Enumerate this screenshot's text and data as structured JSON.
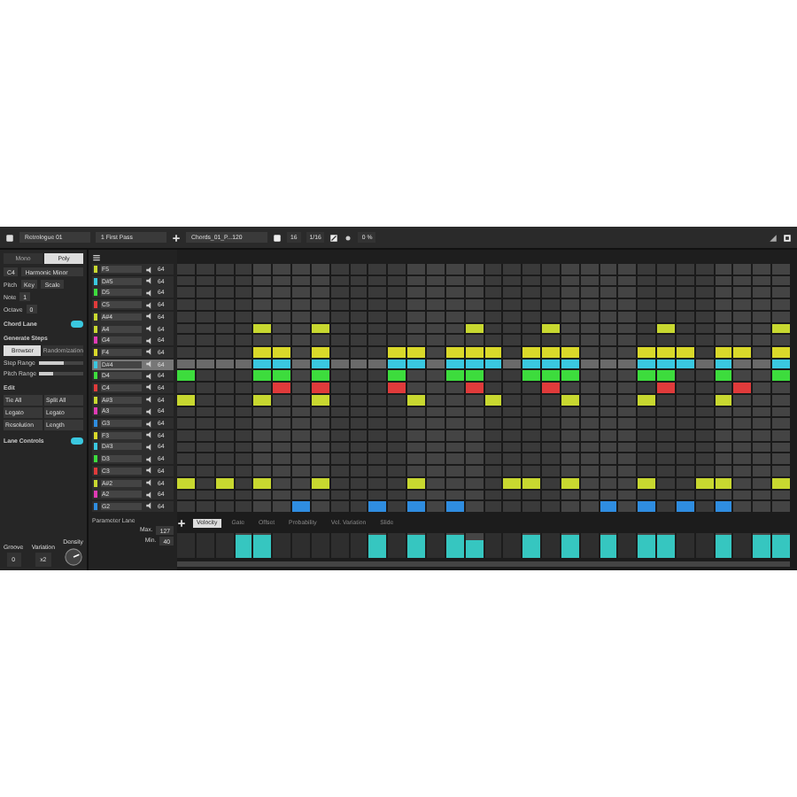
{
  "toolbar": {
    "instrument": "Retrologue 01",
    "pattern": "1 First Pass",
    "preset": "Chords_01_P...120",
    "steps": "16",
    "resolution": "1/16",
    "swing": "0 %"
  },
  "mode_tabs": [
    {
      "label": "Mono",
      "selected": false
    },
    {
      "label": "Poly",
      "selected": true
    }
  ],
  "scale": {
    "root": "C4",
    "name": "Harmonic Minor"
  },
  "rows": [
    {
      "label": "Pitch",
      "value": "Key",
      "value2": "Scale"
    },
    {
      "label": "Note",
      "value": "1"
    },
    {
      "label": "Octave",
      "value": "0"
    }
  ],
  "chord_lane": {
    "label": "Chord Lane",
    "on": true
  },
  "generate": {
    "label": "Generate Steps",
    "tabs": [
      {
        "label": "Browser",
        "selected": true
      },
      {
        "label": "Randomization",
        "selected": false
      }
    ],
    "sliders": [
      {
        "label": "Step Range",
        "level": 0.55
      },
      {
        "label": "Pitch Range",
        "level": 0.3
      }
    ]
  },
  "edit": {
    "label": "Edit",
    "buttons": [
      "Tie All",
      "Split All",
      "Legato",
      "Legato",
      "Resolution",
      "Length"
    ]
  },
  "lane_controls": {
    "label": "Lane Controls",
    "on": true
  },
  "knobs": [
    {
      "label": "Groove",
      "value": "0"
    },
    {
      "label": "Variation",
      "value": "x2"
    },
    {
      "label": "Density"
    }
  ],
  "lanes": [
    {
      "name": "F5",
      "color": "#c8d830",
      "value": "64",
      "selected": false,
      "steps": [
        false,
        false,
        false,
        false,
        false,
        false,
        false,
        false,
        false,
        false,
        false,
        false,
        false,
        false,
        false,
        false,
        false,
        false,
        false,
        false,
        false,
        false,
        false,
        false,
        false,
        false,
        false,
        false,
        false,
        false,
        false,
        false
      ]
    },
    {
      "name": "D#5",
      "color": "#3ac8e0",
      "value": "64",
      "selected": false,
      "steps": [
        false,
        false,
        false,
        false,
        false,
        false,
        false,
        false,
        false,
        false,
        false,
        false,
        false,
        false,
        false,
        false,
        false,
        false,
        false,
        false,
        false,
        false,
        false,
        false,
        false,
        false,
        false,
        false,
        false,
        false,
        false,
        false
      ]
    },
    {
      "name": "D5",
      "color": "#3ddc3d",
      "value": "64",
      "selected": false,
      "steps": [
        false,
        false,
        false,
        false,
        false,
        false,
        false,
        false,
        false,
        false,
        false,
        false,
        false,
        false,
        false,
        false,
        false,
        false,
        false,
        false,
        false,
        false,
        false,
        false,
        false,
        false,
        false,
        false,
        false,
        false,
        false,
        false
      ]
    },
    {
      "name": "C5",
      "color": "#e03b3b",
      "value": "64",
      "selected": false,
      "steps": [
        false,
        false,
        false,
        false,
        false,
        false,
        false,
        false,
        false,
        false,
        false,
        false,
        false,
        false,
        false,
        false,
        false,
        false,
        false,
        false,
        false,
        false,
        false,
        false,
        false,
        false,
        false,
        false,
        false,
        false,
        false,
        false
      ]
    },
    {
      "name": "A#4",
      "color": "#c8d830",
      "value": "64",
      "selected": false,
      "steps": [
        false,
        false,
        false,
        false,
        false,
        false,
        false,
        false,
        false,
        false,
        false,
        false,
        false,
        false,
        false,
        false,
        false,
        false,
        false,
        false,
        false,
        false,
        false,
        false,
        false,
        false,
        false,
        false,
        false,
        false,
        false,
        false
      ]
    },
    {
      "name": "A4",
      "color": "#c8d830",
      "value": "64",
      "selected": false,
      "steps": [
        false,
        false,
        false,
        false,
        true,
        false,
        false,
        true,
        false,
        false,
        false,
        false,
        false,
        false,
        false,
        true,
        false,
        false,
        false,
        true,
        false,
        false,
        false,
        false,
        false,
        true,
        false,
        false,
        false,
        false,
        false,
        true
      ]
    },
    {
      "name": "G4",
      "color": "#e03bb5",
      "value": "64",
      "selected": false,
      "steps": [
        false,
        false,
        false,
        false,
        false,
        false,
        false,
        false,
        false,
        false,
        false,
        false,
        false,
        false,
        false,
        false,
        false,
        false,
        false,
        false,
        false,
        false,
        false,
        false,
        false,
        false,
        false,
        false,
        false,
        false,
        false,
        false
      ]
    },
    {
      "name": "F4",
      "color": "#d9d92a",
      "value": "64",
      "selected": false,
      "steps": [
        false,
        false,
        false,
        false,
        true,
        true,
        false,
        true,
        false,
        false,
        false,
        true,
        true,
        false,
        true,
        true,
        true,
        false,
        true,
        true,
        true,
        false,
        false,
        false,
        true,
        true,
        true,
        false,
        true,
        true,
        false,
        true
      ]
    },
    {
      "name": "D#4",
      "color": "#3ac8e0",
      "value": "64",
      "selected": true,
      "steps": [
        false,
        false,
        false,
        false,
        true,
        true,
        false,
        true,
        false,
        false,
        false,
        true,
        true,
        false,
        true,
        true,
        true,
        false,
        true,
        true,
        true,
        false,
        false,
        false,
        true,
        true,
        true,
        false,
        true,
        false,
        false,
        true
      ]
    },
    {
      "name": "D4",
      "color": "#3ddc3d",
      "value": "64",
      "selected": false,
      "steps": [
        true,
        false,
        false,
        false,
        true,
        true,
        false,
        true,
        false,
        false,
        false,
        true,
        false,
        false,
        true,
        true,
        false,
        false,
        true,
        true,
        true,
        false,
        false,
        false,
        true,
        true,
        false,
        false,
        true,
        false,
        false,
        true
      ]
    },
    {
      "name": "C4",
      "color": "#e03b3b",
      "value": "64",
      "selected": false,
      "steps": [
        false,
        false,
        false,
        false,
        false,
        true,
        false,
        true,
        false,
        false,
        false,
        true,
        false,
        false,
        false,
        true,
        false,
        false,
        false,
        true,
        false,
        false,
        false,
        false,
        false,
        true,
        false,
        false,
        false,
        true,
        false,
        false
      ]
    },
    {
      "name": "A#3",
      "color": "#c8d830",
      "value": "64",
      "selected": false,
      "steps": [
        true,
        false,
        false,
        false,
        true,
        false,
        false,
        true,
        false,
        false,
        false,
        false,
        true,
        false,
        false,
        false,
        true,
        false,
        false,
        false,
        true,
        false,
        false,
        false,
        true,
        false,
        false,
        false,
        true,
        false,
        false,
        false
      ]
    },
    {
      "name": "A3",
      "color": "#e03bb5",
      "value": "64",
      "selected": false,
      "steps": [
        false,
        false,
        false,
        false,
        false,
        false,
        false,
        false,
        false,
        false,
        false,
        false,
        false,
        false,
        false,
        false,
        false,
        false,
        false,
        false,
        false,
        false,
        false,
        false,
        false,
        false,
        false,
        false,
        false,
        false,
        false,
        false
      ]
    },
    {
      "name": "G3",
      "color": "#2f8de0",
      "value": "64",
      "selected": false,
      "steps": [
        false,
        false,
        false,
        false,
        false,
        false,
        false,
        false,
        false,
        false,
        false,
        false,
        false,
        false,
        false,
        false,
        false,
        false,
        false,
        false,
        false,
        false,
        false,
        false,
        false,
        false,
        false,
        false,
        false,
        false,
        false,
        false
      ]
    },
    {
      "name": "F3",
      "color": "#d9d92a",
      "value": "64",
      "selected": false,
      "steps": [
        false,
        false,
        false,
        false,
        false,
        false,
        false,
        false,
        false,
        false,
        false,
        false,
        false,
        false,
        false,
        false,
        false,
        false,
        false,
        false,
        false,
        false,
        false,
        false,
        false,
        false,
        false,
        false,
        false,
        false,
        false,
        false
      ]
    },
    {
      "name": "D#3",
      "color": "#3ac8e0",
      "value": "64",
      "selected": false,
      "steps": [
        false,
        false,
        false,
        false,
        false,
        false,
        false,
        false,
        false,
        false,
        false,
        false,
        false,
        false,
        false,
        false,
        false,
        false,
        false,
        false,
        false,
        false,
        false,
        false,
        false,
        false,
        false,
        false,
        false,
        false,
        false,
        false
      ]
    },
    {
      "name": "D3",
      "color": "#3ddc3d",
      "value": "64",
      "selected": false,
      "steps": [
        false,
        false,
        false,
        false,
        false,
        false,
        false,
        false,
        false,
        false,
        false,
        false,
        false,
        false,
        false,
        false,
        false,
        false,
        false,
        false,
        false,
        false,
        false,
        false,
        false,
        false,
        false,
        false,
        false,
        false,
        false,
        false
      ]
    },
    {
      "name": "C3",
      "color": "#e03b3b",
      "value": "64",
      "selected": false,
      "steps": [
        false,
        false,
        false,
        false,
        false,
        false,
        false,
        false,
        false,
        false,
        false,
        false,
        false,
        false,
        false,
        false,
        false,
        false,
        false,
        false,
        false,
        false,
        false,
        false,
        false,
        false,
        false,
        false,
        false,
        false,
        false,
        false
      ]
    },
    {
      "name": "A#2",
      "color": "#c8d830",
      "value": "64",
      "selected": false,
      "steps": [
        true,
        false,
        true,
        false,
        true,
        false,
        false,
        true,
        false,
        false,
        false,
        false,
        true,
        false,
        false,
        false,
        false,
        true,
        true,
        false,
        true,
        false,
        false,
        false,
        true,
        false,
        false,
        true,
        true,
        false,
        false,
        true
      ]
    },
    {
      "name": "A2",
      "color": "#e03bb5",
      "value": "64",
      "selected": false,
      "steps": [
        false,
        false,
        false,
        false,
        false,
        false,
        false,
        false,
        false,
        false,
        false,
        false,
        false,
        false,
        false,
        false,
        false,
        false,
        false,
        false,
        false,
        false,
        false,
        false,
        false,
        false,
        false,
        false,
        false,
        false,
        false,
        false
      ]
    },
    {
      "name": "G2",
      "color": "#2f8de0",
      "value": "64",
      "selected": false,
      "steps": [
        false,
        false,
        false,
        false,
        false,
        false,
        true,
        false,
        false,
        false,
        true,
        false,
        true,
        false,
        true,
        false,
        false,
        false,
        false,
        false,
        false,
        false,
        true,
        false,
        true,
        false,
        true,
        false,
        true,
        false,
        false,
        false
      ]
    }
  ],
  "parameter_tabs": [
    {
      "label": "Velocity",
      "selected": true
    },
    {
      "label": "Gate",
      "selected": false
    },
    {
      "label": "Offset",
      "selected": false
    },
    {
      "label": "Probability",
      "selected": false
    },
    {
      "label": "Vel. Variation",
      "selected": false
    },
    {
      "label": "Slide",
      "selected": false
    }
  ],
  "parameter_lane": {
    "label": "Parameter Lane",
    "max_label": "Max.",
    "max": "127",
    "min_label": "Min.",
    "min": "40"
  },
  "velocity": [
    {
      "active": false
    },
    {
      "active": false
    },
    {
      "active": false
    },
    {
      "active": true,
      "level": 0.9
    },
    {
      "active": true,
      "level": 0.9
    },
    {
      "active": false
    },
    {
      "active": false
    },
    {
      "active": false
    },
    {
      "active": false
    },
    {
      "active": false
    },
    {
      "active": true,
      "level": 0.9
    },
    {
      "active": false
    },
    {
      "active": true,
      "level": 0.9
    },
    {
      "active": false
    },
    {
      "active": true,
      "level": 0.9
    },
    {
      "active": true,
      "level": 0.7
    },
    {
      "active": false
    },
    {
      "active": false
    },
    {
      "active": true,
      "level": 0.9
    },
    {
      "active": false
    },
    {
      "active": true,
      "level": 0.9
    },
    {
      "active": false
    },
    {
      "active": true,
      "level": 0.9
    },
    {
      "active": false
    },
    {
      "active": true,
      "level": 0.9
    },
    {
      "active": true,
      "level": 0.9
    },
    {
      "active": false
    },
    {
      "active": false
    },
    {
      "active": true,
      "level": 0.9
    },
    {
      "active": false
    },
    {
      "active": true,
      "level": 0.9
    },
    {
      "active": true,
      "level": 0.9
    }
  ]
}
